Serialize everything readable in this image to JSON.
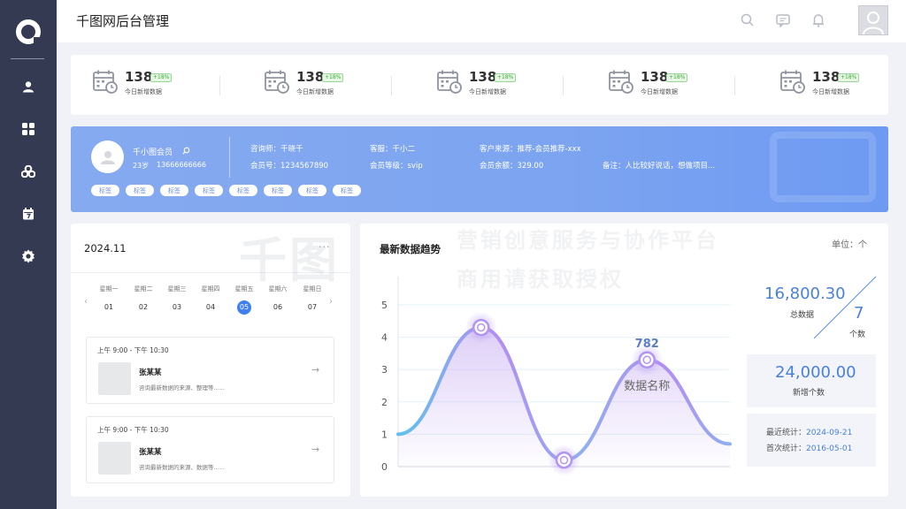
{
  "app": {
    "title": "千图网后台管理"
  },
  "sidebar": {
    "items": [
      {
        "icon": "user-icon"
      },
      {
        "icon": "grid-icon"
      },
      {
        "icon": "biohazard-icon"
      },
      {
        "icon": "calendar-icon"
      },
      {
        "icon": "gear-icon"
      }
    ]
  },
  "header": {
    "icons": [
      "search-icon",
      "message-icon",
      "bell-icon"
    ],
    "avatar": "user-avatar-icon"
  },
  "stats": [
    {
      "value": "138",
      "badge": "+18%",
      "label": "今日新增数据"
    },
    {
      "value": "138",
      "badge": "+18%",
      "label": "今日新增数据"
    },
    {
      "value": "138",
      "badge": "+18%",
      "label": "今日新增数据"
    },
    {
      "value": "138",
      "badge": "+18%",
      "label": "今日新增数据"
    },
    {
      "value": "138",
      "badge": "+18%",
      "label": "今日新增数据"
    }
  ],
  "member": {
    "name": "千小图会员",
    "age": "23岁",
    "phone": "13666666666",
    "consultant": "咨询师：千晓千",
    "service": "客服：千小二",
    "source": "客户来源：推荐-会员推荐-xxx",
    "member_no": "会员号：1234567890",
    "level": "会员等级：svip",
    "balance": "会员余额：329.00",
    "note": "备注：人比较好说话，想做项目...",
    "tags": [
      "标签",
      "标签",
      "标签",
      "标签",
      "标签",
      "标签",
      "标签",
      "标签"
    ]
  },
  "calendar": {
    "title": "2024.11",
    "more": "···",
    "days": [
      {
        "weekday": "星期一",
        "date": "01"
      },
      {
        "weekday": "星期二",
        "date": "02"
      },
      {
        "weekday": "星期三",
        "date": "03"
      },
      {
        "weekday": "星期四",
        "date": "04"
      },
      {
        "weekday": "星期五",
        "date": "05"
      },
      {
        "weekday": "星期六",
        "date": "06"
      },
      {
        "weekday": "星期日",
        "date": "07"
      }
    ],
    "active_index": 4,
    "events": [
      {
        "time": "上午 9:00 - 下午 10:30",
        "name": "张某某",
        "desc": "咨询最新数据的来源、整理等......"
      },
      {
        "time": "上午 9:00 - 下午 10:30",
        "name": "张某某",
        "desc": "咨询最新数据的来源、数据等......"
      }
    ]
  },
  "chart": {
    "title": "最新数据趋势",
    "unit": "单位：个",
    "annotation_value": "782",
    "annotation_label": "数据名称"
  },
  "chart_data": {
    "type": "area",
    "title": "最新数据趋势",
    "xlabel": "",
    "ylabel": "",
    "yticks": [
      "5",
      "4",
      "3",
      "2",
      "1",
      "0"
    ],
    "ylim": [
      0,
      5
    ],
    "x": [
      0,
      1,
      2,
      3,
      4
    ],
    "values": [
      1.0,
      4.3,
      0.2,
      3.3,
      0.7
    ],
    "highlight_points": [
      1,
      2,
      3
    ],
    "colors": {
      "line_start": "#5ec3ee",
      "line_end": "#b48ef0",
      "area": "#c4a8f2"
    }
  },
  "kpis": {
    "total_value": "16,800.30",
    "total_label": "总数据",
    "count_value": "7",
    "count_label": "个数",
    "new_value": "24,000.00",
    "new_label": "新增个数",
    "recent_label": "最近统计：",
    "recent_value": "2024-09-21",
    "first_label": "首次统计：",
    "first_value": "2016-05-01"
  },
  "watermark": {
    "brand": "千图",
    "line1": "营销创意服务与协作平台",
    "line2": "商用请获取授权"
  }
}
